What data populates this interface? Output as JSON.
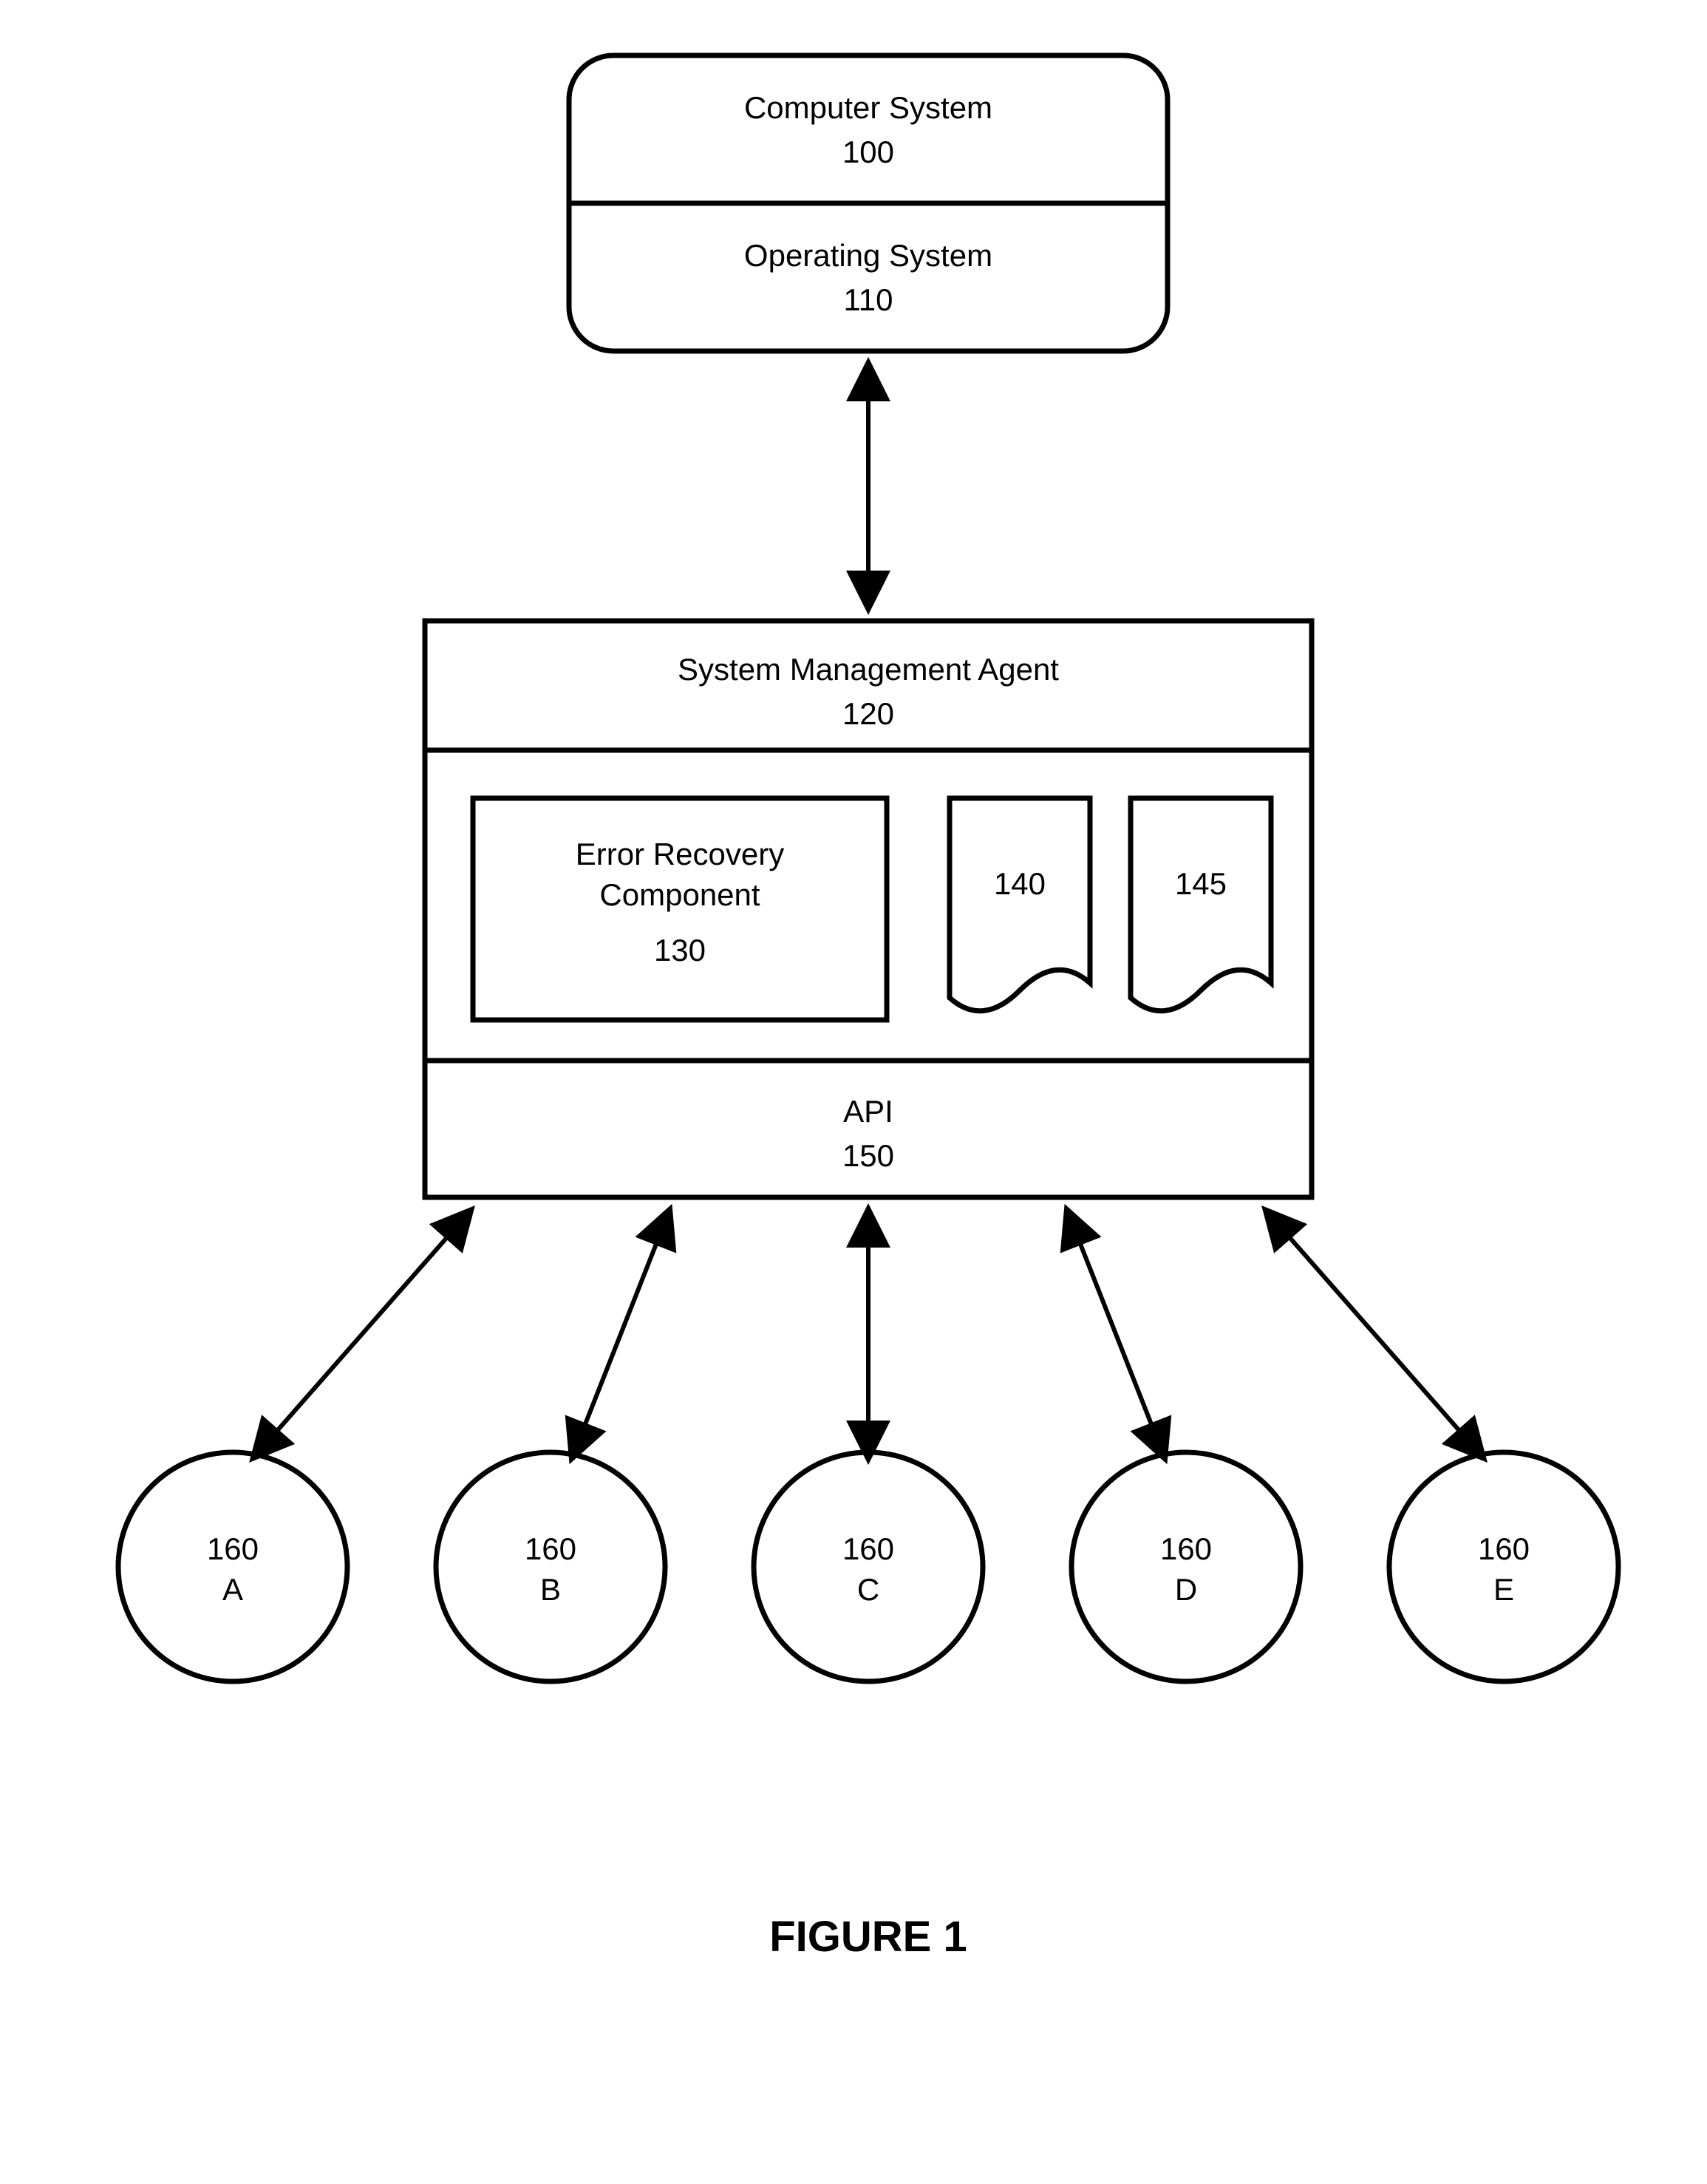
{
  "top_box": {
    "line1": "Computer System",
    "num1": "100",
    "line2": "Operating System",
    "num2": "110"
  },
  "agent_box": {
    "title_line": "System Management Agent",
    "title_num": "120",
    "error_box_line1": "Error Recovery",
    "error_box_line2": "Component",
    "error_box_num": "130",
    "doc1_num": "140",
    "doc2_num": "145",
    "api_line": "API",
    "api_num": "150"
  },
  "circles": [
    {
      "num": "160",
      "letter": "A"
    },
    {
      "num": "160",
      "letter": "B"
    },
    {
      "num": "160",
      "letter": "C"
    },
    {
      "num": "160",
      "letter": "D"
    },
    {
      "num": "160",
      "letter": "E"
    }
  ],
  "figure_label": "FIGURE 1"
}
